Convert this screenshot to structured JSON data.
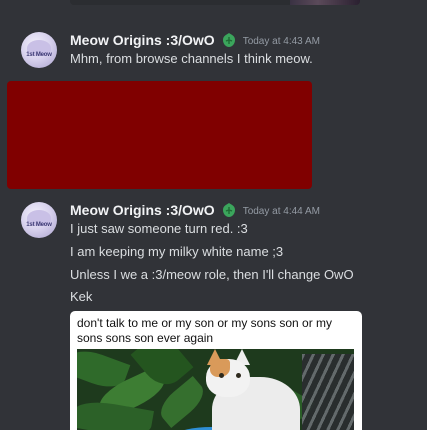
{
  "messages": [
    {
      "username": "Meow Origins :3/OwO",
      "avatar_text": "1st Meow",
      "badge_icon": "green-leaf-badge-icon",
      "timestamp": "Today at 4:43 AM",
      "lines": [
        "Mhm, from browse channels I think meow."
      ]
    },
    {
      "username": "Meow Origins :3/OwO",
      "avatar_text": "1st Meow",
      "badge_icon": "green-leaf-badge-icon",
      "timestamp": "Today at 4:44 AM",
      "lines": [
        "I just saw someone turn red. :3",
        "I am keeping my milky white name ;3",
        "Unless I we a :3/meow role, then I'll change OwO",
        "Kek"
      ],
      "meme_caption": "don't talk to me or my son or my sons son or my sons sons son ever again"
    }
  ],
  "colors": {
    "background": "#313338",
    "redacted_block": "#800000",
    "username": "#f2f3f5",
    "message_text": "#dbdee1",
    "timestamp": "#949ba4",
    "badge": "#3ba55c"
  }
}
